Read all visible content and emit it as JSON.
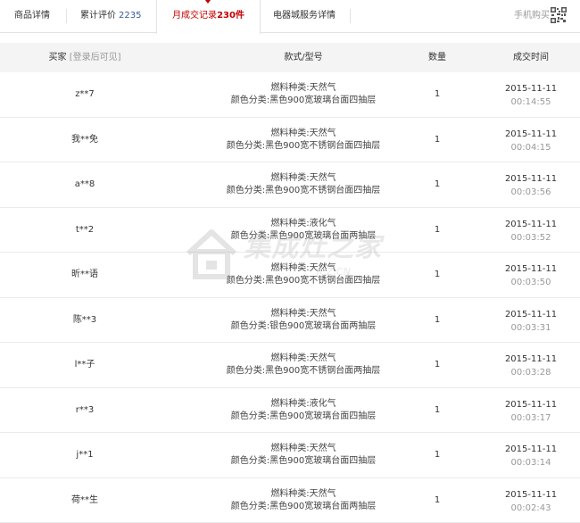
{
  "tabs": [
    {
      "label": "商品详情",
      "count": ""
    },
    {
      "label": "累计评价",
      "count": "2235"
    },
    {
      "label": "月成交记录",
      "count": "230件"
    },
    {
      "label": "电器城服务详情",
      "count": ""
    }
  ],
  "mobile_buy": "手机购买",
  "table": {
    "headers": {
      "buyer": "买家",
      "buyer_hint": "[登录后可见]",
      "sku": "款式/型号",
      "qty": "数量",
      "time": "成交时间"
    },
    "rows": [
      {
        "buyer": "z**7",
        "fuel": "燃料种类:天然气",
        "color": "颜色分类:黑色900宽玻璃台面四抽层",
        "qty": "1",
        "date": "2015-11-11",
        "time": "00:14:55"
      },
      {
        "buyer": "我**免",
        "fuel": "燃料种类:天然气",
        "color": "颜色分类:黑色900宽不锈钢台面四抽层",
        "qty": "1",
        "date": "2015-11-11",
        "time": "00:04:15"
      },
      {
        "buyer": "a**8",
        "fuel": "燃料种类:天然气",
        "color": "颜色分类:黑色900宽不锈钢台面四抽层",
        "qty": "1",
        "date": "2015-11-11",
        "time": "00:03:56"
      },
      {
        "buyer": "t**2",
        "fuel": "燃料种类:液化气",
        "color": "颜色分类:黑色900宽玻璃台面两抽层",
        "qty": "1",
        "date": "2015-11-11",
        "time": "00:03:52"
      },
      {
        "buyer": "昕**语",
        "fuel": "燃料种类:天然气",
        "color": "颜色分类:黑色900宽不锈钢台面四抽层",
        "qty": "1",
        "date": "2015-11-11",
        "time": "00:03:50"
      },
      {
        "buyer": "陈**3",
        "fuel": "燃料种类:天然气",
        "color": "颜色分类:银色900宽玻璃台面两抽层",
        "qty": "1",
        "date": "2015-11-11",
        "time": "00:03:31"
      },
      {
        "buyer": "l**子",
        "fuel": "燃料种类:天然气",
        "color": "颜色分类:黑色900宽不锈钢台面两抽层",
        "qty": "1",
        "date": "2015-11-11",
        "time": "00:03:28"
      },
      {
        "buyer": "r**3",
        "fuel": "燃料种类:液化气",
        "color": "颜色分类:黑色900宽玻璃台面四抽层",
        "qty": "1",
        "date": "2015-11-11",
        "time": "00:03:17"
      },
      {
        "buyer": "j**1",
        "fuel": "燃料种类:天然气",
        "color": "颜色分类:黑色900宽玻璃台面四抽层",
        "qty": "1",
        "date": "2015-11-11",
        "time": "00:03:14"
      },
      {
        "buyer": "荷**生",
        "fuel": "燃料种类:天然气",
        "color": "颜色分类:黑色900宽玻璃台面两抽层",
        "qty": "1",
        "date": "2015-11-11",
        "time": "00:02:43"
      }
    ]
  },
  "watermark": {
    "text": "集成灶之家",
    "url": "JCZ.CN"
  },
  "colors": {
    "accent": "#c40000",
    "count_blue": "#3b5a9a",
    "header_bg": "#f4f4f4",
    "muted": "#999999"
  }
}
